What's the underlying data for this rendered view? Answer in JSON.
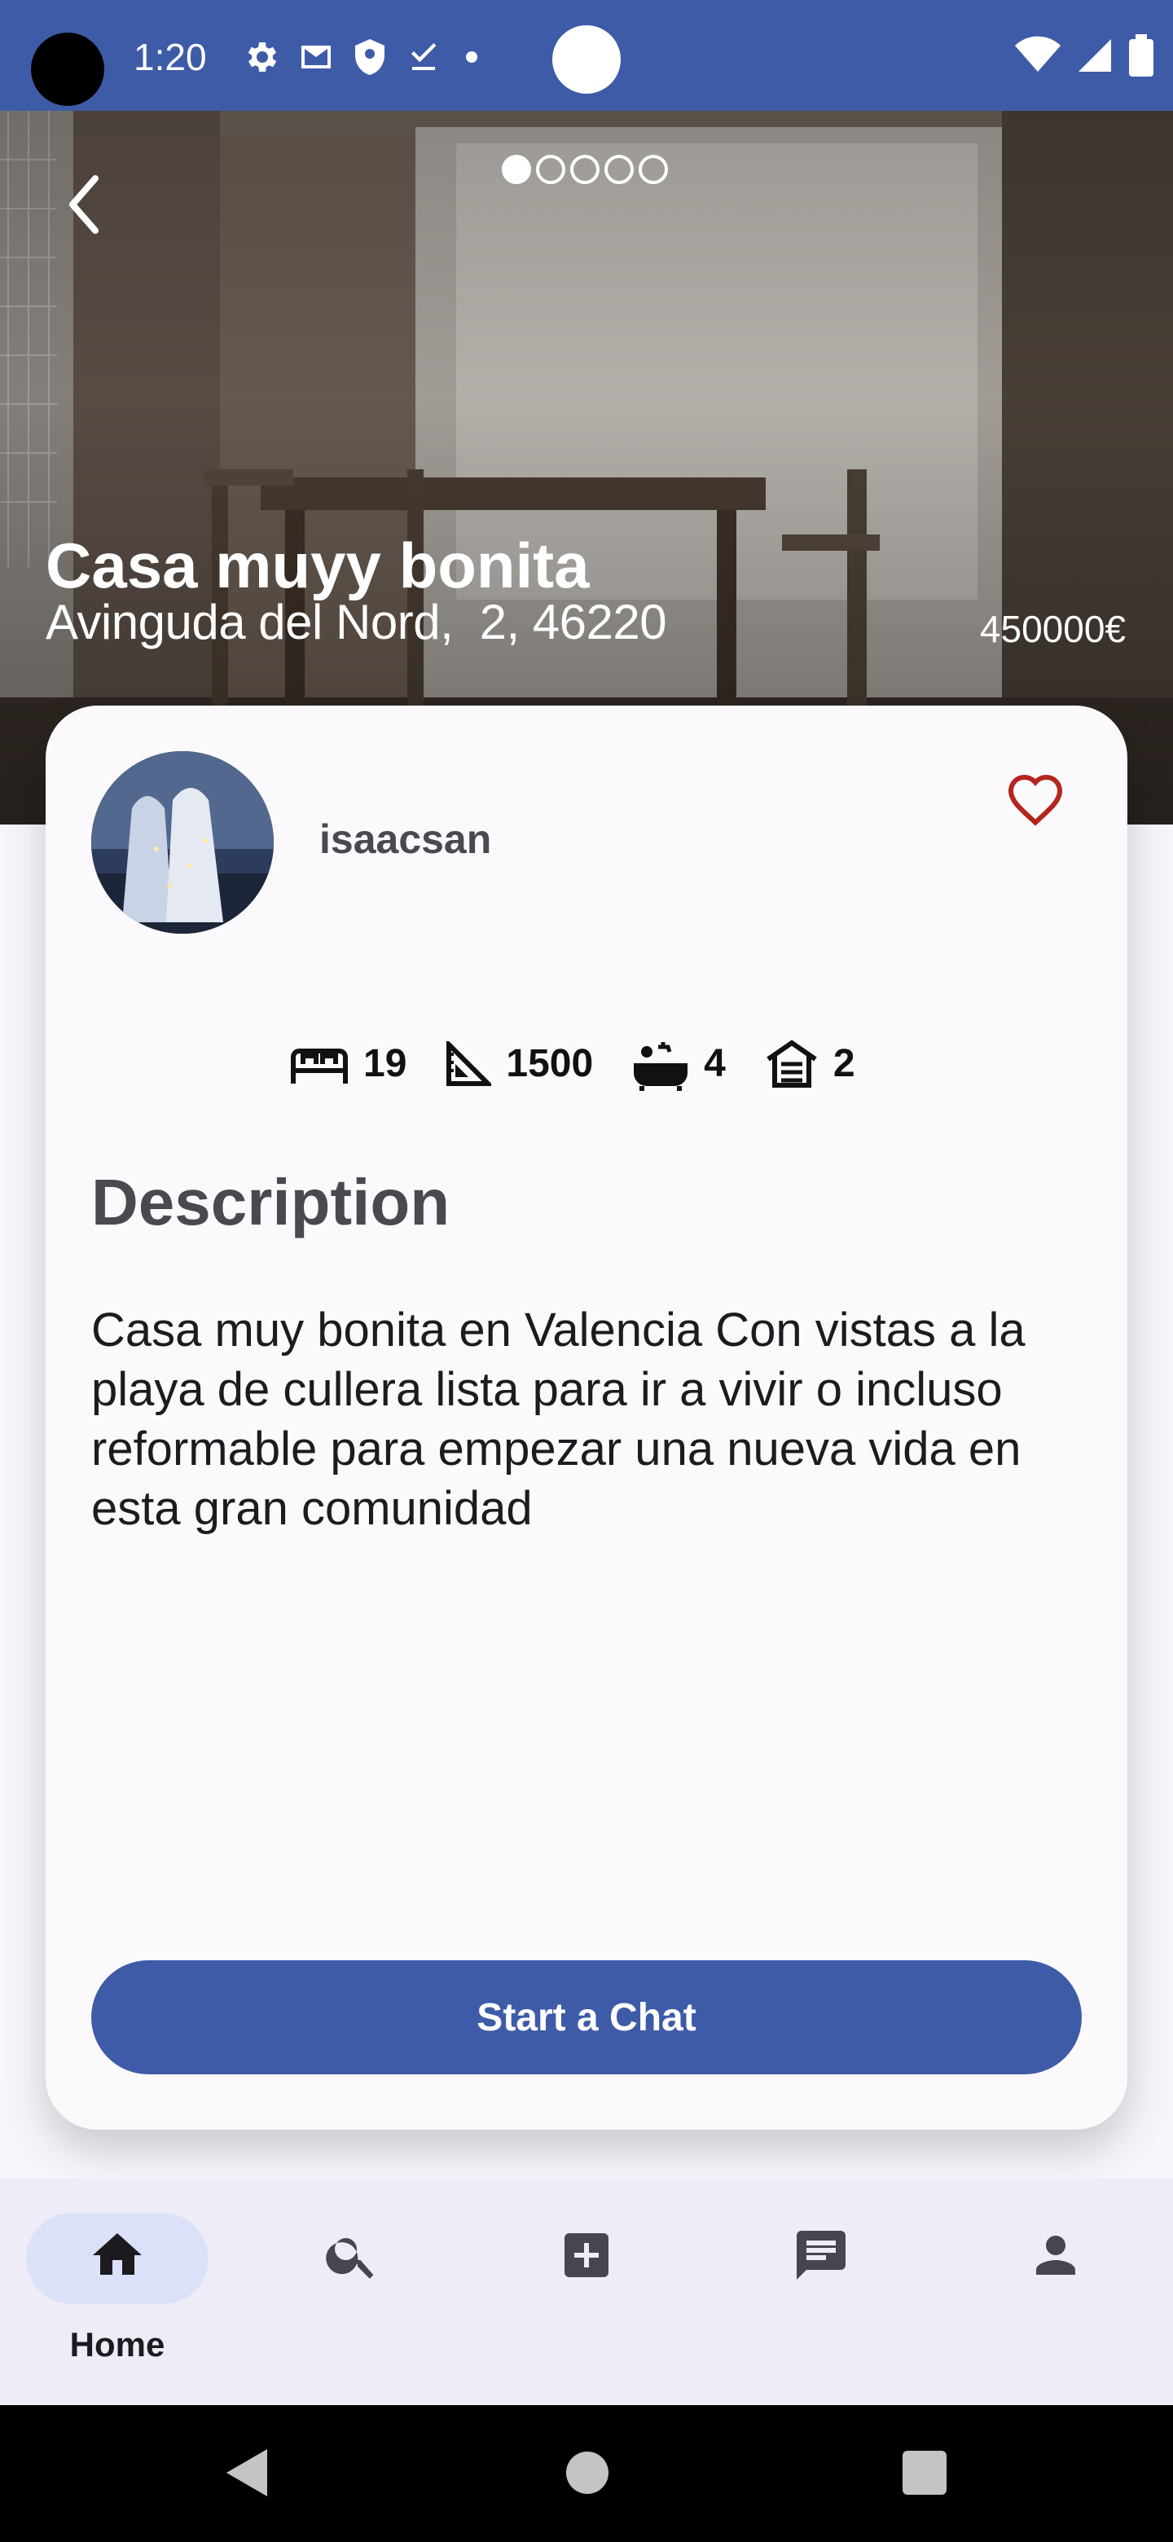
{
  "status_bar": {
    "time": "1:20",
    "left_icons": [
      "settings-icon",
      "gmail-icon",
      "shield-icon",
      "download-done-icon",
      "dot-icon"
    ],
    "right_icons": [
      "wifi-icon",
      "signal-icon",
      "battery-icon"
    ],
    "color": "#3e5ba8"
  },
  "hero": {
    "back_icon": "chevron-left-icon",
    "photo_count": 5,
    "active_photo": 1,
    "title": "Casa muyy bonita",
    "address": "Avinguda del Nord,  2, 46220",
    "price": "450000€"
  },
  "card": {
    "username": "isaacsan",
    "favorite_icon": "heart-outline-icon",
    "features": [
      {
        "icon": "bed-icon",
        "value": "19"
      },
      {
        "icon": "square-meters-icon",
        "value": "1500"
      },
      {
        "icon": "bathtub-icon",
        "value": "4"
      },
      {
        "icon": "garage-icon",
        "value": "2"
      }
    ],
    "description_heading": "Description",
    "description_text": "Casa muy bonita en Valencia Con vistas a la playa de cullera lista para ir a vivir o incluso reformable para empezar una nueva vida en esta gran comunidad",
    "chat_button_label": "Start a Chat",
    "accent_color": "#3e5ba8",
    "favorite_color": "#b3261e"
  },
  "bottom_nav": {
    "items": [
      {
        "icon": "home-icon",
        "label": "Home",
        "selected": true
      },
      {
        "icon": "search-icon",
        "label": "",
        "selected": false
      },
      {
        "icon": "add-box-icon",
        "label": "",
        "selected": false
      },
      {
        "icon": "chat-icon",
        "label": "",
        "selected": false
      },
      {
        "icon": "person-icon",
        "label": "",
        "selected": false
      }
    ]
  },
  "system_nav": {
    "buttons": [
      "back-triangle-icon",
      "home-circle-icon",
      "recents-square-icon"
    ]
  }
}
